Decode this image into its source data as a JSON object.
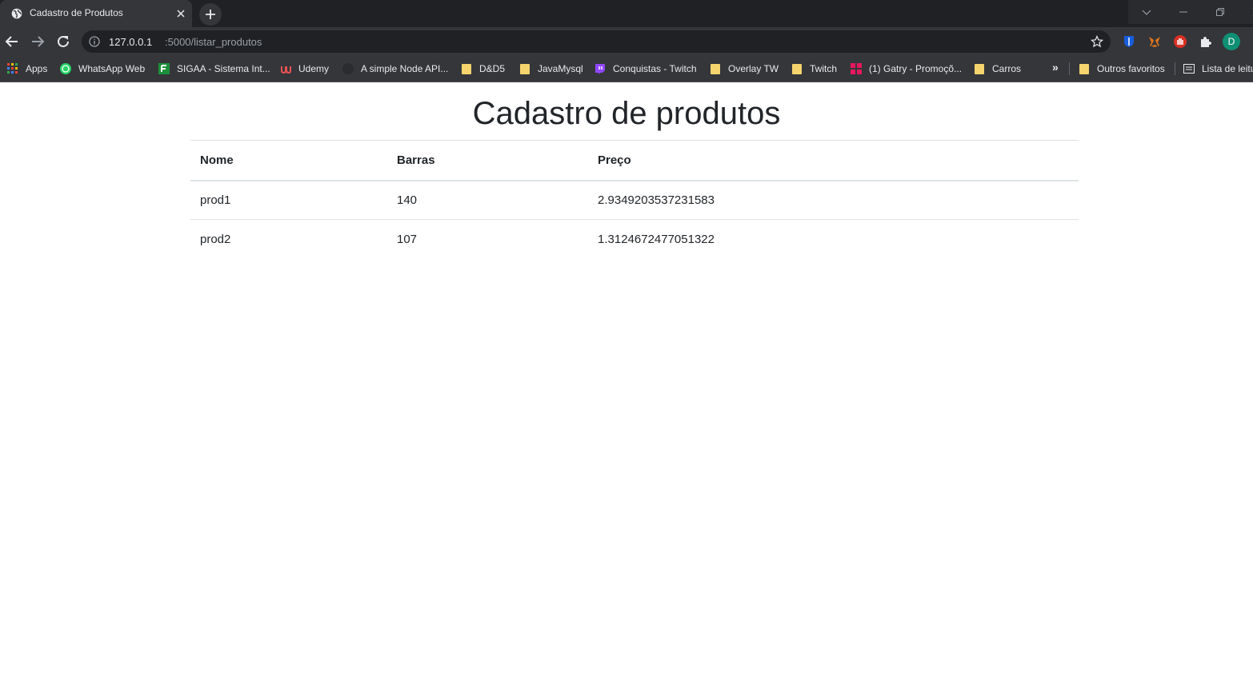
{
  "browser": {
    "tab": {
      "title": "Cadastro de Produtos",
      "favicon": "globe-icon"
    },
    "url": {
      "host": "127.0.0.1",
      "path": ":5000/listar_produtos"
    },
    "avatar_letter": "D",
    "bookmarks": [
      {
        "label": "Apps",
        "icon": "apps-grid-icon"
      },
      {
        "label": "WhatsApp Web",
        "icon": "whatsapp-icon"
      },
      {
        "label": "SIGAA - Sistema Int...",
        "icon": "sigaa-icon"
      },
      {
        "label": "Udemy",
        "icon": "udemy-icon"
      },
      {
        "label": "A simple Node API...",
        "icon": "github-icon"
      },
      {
        "label": "D&D5",
        "icon": "folder-icon"
      },
      {
        "label": "JavaMysql",
        "icon": "folder-icon"
      },
      {
        "label": "Conquistas - Twitch",
        "icon": "twitch-icon"
      },
      {
        "label": "Overlay TW",
        "icon": "folder-icon"
      },
      {
        "label": "Twitch",
        "icon": "folder-icon"
      },
      {
        "label": "(1) Gatry - Promoçõ...",
        "icon": "gatry-icon"
      },
      {
        "label": "Carros",
        "icon": "folder-icon"
      },
      {
        "label": "Outros favoritos",
        "icon": "folder-icon"
      },
      {
        "label": "Lista de leitu",
        "icon": "reading-list-icon"
      }
    ],
    "colors": {
      "chrome_dark": "#202124",
      "chrome_mid": "#35363a",
      "folder": "#f5d46e",
      "avatar": "#0f8f74"
    }
  },
  "page": {
    "title": "Cadastro de produtos",
    "table": {
      "headers": [
        "Nome",
        "Barras",
        "Preço"
      ],
      "rows": [
        [
          "prod1",
          "140",
          "2.9349203537231583"
        ],
        [
          "prod2",
          "107",
          "1.3124672477051322"
        ]
      ]
    }
  }
}
